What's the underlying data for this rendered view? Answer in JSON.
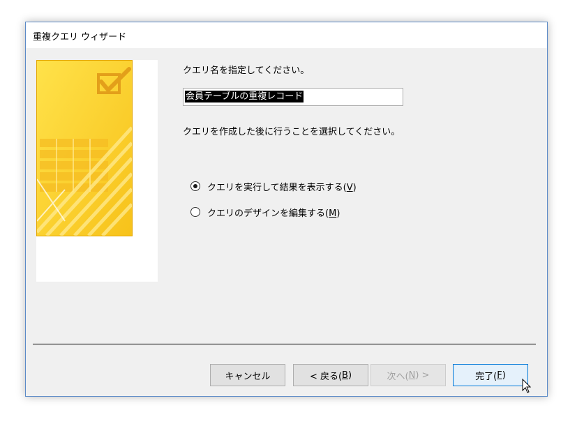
{
  "window": {
    "title": "重複クエリ ウィザード"
  },
  "prompt_name": "クエリ名を指定してください。",
  "query_name_value": "会員テーブルの重複レコード",
  "prompt_action": "クエリを作成した後に行うことを選択してください。",
  "options": [
    {
      "label": "クエリを実行して結果を表示する",
      "mnemonic": "V",
      "checked": true
    },
    {
      "label": "クエリのデザインを編集する",
      "mnemonic": "M",
      "checked": false
    }
  ],
  "buttons": {
    "cancel": {
      "label": "キャンセル"
    },
    "back": {
      "prefix": "< 戻る(",
      "mnemonic": "B",
      "suffix": ")"
    },
    "next": {
      "prefix": "次へ(",
      "mnemonic": "N",
      "suffix": ") >",
      "disabled": true
    },
    "finish": {
      "prefix": "完了(",
      "mnemonic": "F",
      "suffix": ")"
    }
  },
  "colors": {
    "art_yellow": "#ffd633",
    "art_orange": "#f5b800",
    "art_check": "#e39f1a",
    "focus_blue": "#0078d7"
  },
  "icons": {
    "art": "wizard-graphic-icon",
    "cursor": "mouse-pointer-icon"
  }
}
